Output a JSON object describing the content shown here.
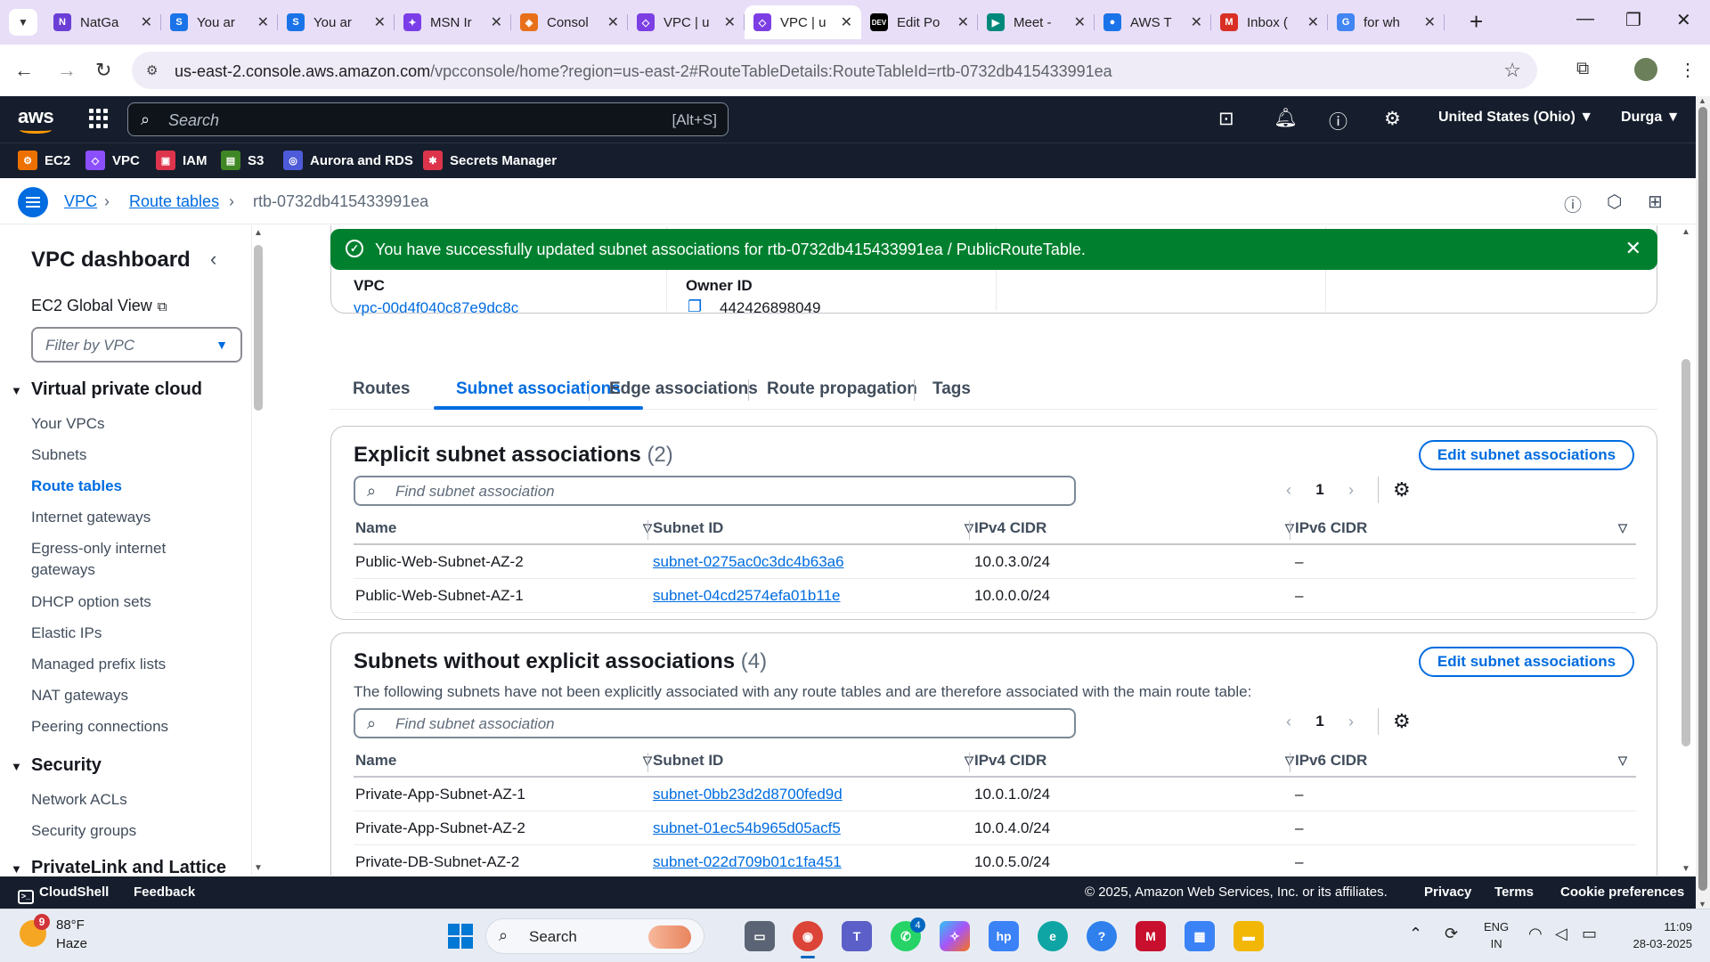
{
  "browser": {
    "tabs": [
      {
        "title": "NatGa",
        "icon": "natgeo-icon",
        "color": "#6b3fd6",
        "glyph": "N"
      },
      {
        "title": "You ar",
        "icon": "s-icon",
        "color": "#1a73e8",
        "glyph": "S"
      },
      {
        "title": "You ar",
        "icon": "s-icon",
        "color": "#1a73e8",
        "glyph": "S"
      },
      {
        "title": "MSN Ir",
        "icon": "msn-butterfly-icon",
        "color": "#7a3ee8",
        "glyph": "✦"
      },
      {
        "title": "Consol",
        "icon": "aws-console-icon",
        "color": "#e8701a",
        "glyph": "◈"
      },
      {
        "title": "VPC | u",
        "icon": "vpc-icon",
        "color": "#7b3fe4",
        "glyph": "◇"
      },
      {
        "title": "VPC | u",
        "icon": "vpc-icon",
        "color": "#7b3fe4",
        "glyph": "◇",
        "active": true
      },
      {
        "title": "Edit Po",
        "icon": "dev-icon",
        "color": "#000000",
        "glyph": "DEV"
      },
      {
        "title": "Meet -",
        "icon": "meet-icon",
        "color": "#00897b",
        "glyph": "▶"
      },
      {
        "title": "AWS T",
        "icon": "aws-t-icon",
        "color": "#1a73e8",
        "glyph": "●"
      },
      {
        "title": "Inbox (",
        "icon": "gmail-icon",
        "color": "#d93025",
        "glyph": "M"
      },
      {
        "title": "for wh",
        "icon": "google-icon",
        "color": "#4285f4",
        "glyph": "G"
      }
    ],
    "url_host": "us-east-2.console.aws.amazon.com",
    "url_path": "/vpcconsole/home?region=us-east-2#RouteTableDetails:RouteTableId=rtb-0732db415433991ea"
  },
  "aws_header": {
    "logo": "aws",
    "search_placeholder": "Search",
    "search_shortcut": "[Alt+S]",
    "region": "United States (Ohio) ▼",
    "user": "Durga ▼"
  },
  "favorites": [
    {
      "label": "EC2",
      "color": "#ed7100",
      "glyph": "⚙"
    },
    {
      "label": "VPC",
      "color": "#8c4fff",
      "glyph": "◇"
    },
    {
      "label": "IAM",
      "color": "#dd344c",
      "glyph": "▣"
    },
    {
      "label": "S3",
      "color": "#3f8624",
      "glyph": "▤"
    },
    {
      "label": "Aurora and RDS",
      "color": "#4d5bd9",
      "glyph": "◎"
    },
    {
      "label": "Secrets Manager",
      "color": "#dd344c",
      "glyph": "✱"
    }
  ],
  "breadcrumb": {
    "items": [
      "VPC",
      "Route tables"
    ],
    "current": "rtb-0732db415433991ea"
  },
  "sidebar": {
    "title": "VPC dashboard",
    "global_view": "EC2 Global View",
    "filter_placeholder": "Filter by VPC",
    "section_vpc": "Virtual private cloud",
    "vpc_items": [
      "Your VPCs",
      "Subnets",
      "Route tables",
      "Internet gateways",
      "Egress-only internet",
      "gateways",
      "DHCP option sets",
      "Elastic IPs",
      "Managed prefix lists",
      "NAT gateways",
      "Peering connections"
    ],
    "section_security": "Security",
    "security_items": [
      "Network ACLs",
      "Security groups"
    ],
    "section_privatelink": "PrivateLink and Lattice"
  },
  "flash": {
    "message": "You have successfully updated subnet associations for rtb-0732db415433991ea / PublicRouteTable."
  },
  "details": {
    "vpc_label": "VPC",
    "vpc_value": "vpc-00d4f040c87e9dc8c",
    "owner_label": "Owner ID",
    "owner_value": "442426898049"
  },
  "content_tabs": [
    "Routes",
    "Subnet associations",
    "Edge associations",
    "Route propagation",
    "Tags"
  ],
  "explicit": {
    "title": "Explicit subnet associations",
    "count": "(2)",
    "edit_label": "Edit subnet associations",
    "find_placeholder": "Find subnet association",
    "page": "1",
    "columns": [
      "Name",
      "Subnet ID",
      "IPv4 CIDR",
      "IPv6 CIDR"
    ],
    "rows": [
      {
        "name": "Public-Web-Subnet-AZ-2",
        "subnet": "subnet-0275ac0c3dc4b63a6",
        "ipv4": "10.0.3.0/24",
        "ipv6": "–"
      },
      {
        "name": "Public-Web-Subnet-AZ-1",
        "subnet": "subnet-04cd2574efa01b11e",
        "ipv4": "10.0.0.0/24",
        "ipv6": "–"
      }
    ]
  },
  "implicit": {
    "title": "Subnets without explicit associations",
    "count": "(4)",
    "description": "The following subnets have not been explicitly associated with any route tables and are therefore associated with the main route table:",
    "edit_label": "Edit subnet associations",
    "find_placeholder": "Find subnet association",
    "page": "1",
    "columns": [
      "Name",
      "Subnet ID",
      "IPv4 CIDR",
      "IPv6 CIDR"
    ],
    "rows": [
      {
        "name": "Private-App-Subnet-AZ-1",
        "subnet": "subnet-0bb23d2d8700fed9d",
        "ipv4": "10.0.1.0/24",
        "ipv6": "–"
      },
      {
        "name": "Private-App-Subnet-AZ-2",
        "subnet": "subnet-01ec54b965d05acf5",
        "ipv4": "10.0.4.0/24",
        "ipv6": "–"
      },
      {
        "name": "Private-DB-Subnet-AZ-2",
        "subnet": "subnet-022d709b01c1fa451",
        "ipv4": "10.0.5.0/24",
        "ipv6": "–"
      }
    ]
  },
  "aws_footer": {
    "cloudshell": "CloudShell",
    "feedback": "Feedback",
    "copyright": "© 2025, Amazon Web Services, Inc. or its affiliates.",
    "privacy": "Privacy",
    "terms": "Terms",
    "cookies": "Cookie preferences"
  },
  "taskbar": {
    "weather_badge": "9",
    "temperature": "88°F",
    "condition": "Haze",
    "search_label": "Search",
    "teams_badge": "4",
    "lang_top": "ENG",
    "lang_bottom": "IN",
    "time": "11:09",
    "date": "28-03-2025"
  },
  "colors": {
    "aws_nav": "#161e2d",
    "link": "#006ce0",
    "success": "#00802f",
    "tab_strip": "#e8def8"
  }
}
